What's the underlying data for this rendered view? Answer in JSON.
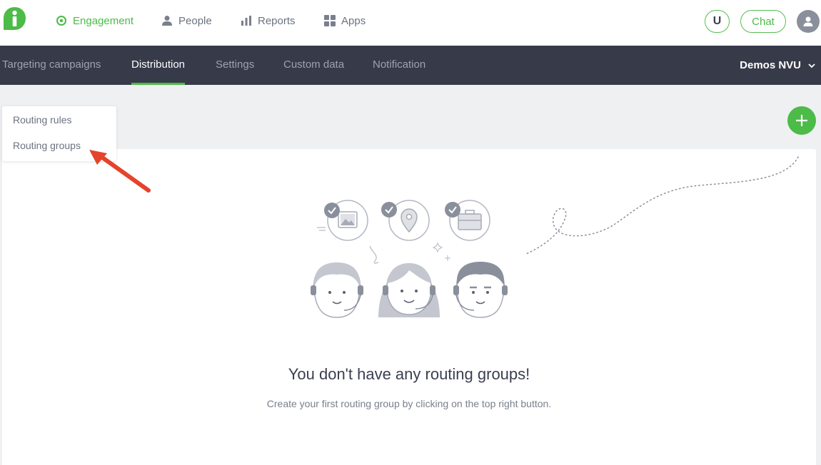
{
  "nav": {
    "engagement": "Engagement",
    "people": "People",
    "reports": "Reports",
    "apps": "Apps",
    "u_button": "U",
    "chat": "Chat"
  },
  "subnav": {
    "tabs": [
      "Targeting campaigns",
      "Distribution",
      "Settings",
      "Custom data",
      "Notification"
    ],
    "active_tab": "Distribution",
    "account": "Demos NVU"
  },
  "side_menu": {
    "items": [
      "Routing rules",
      "Routing groups"
    ]
  },
  "empty_state": {
    "title": "You don't have any routing groups!",
    "subtitle": "Create your first routing group by clicking on the top right button."
  },
  "colors": {
    "brand_green": "#4cbb47",
    "subnav_bg": "#363a49",
    "annotation_arrow": "#e5432b"
  },
  "icons": {
    "logo": "iadvize-logo",
    "engagement": "target-icon",
    "people": "person-icon",
    "reports": "bar-chart-icon",
    "apps": "grid-icon",
    "account_caret": "chevron-down-icon",
    "add": "plus-icon"
  }
}
